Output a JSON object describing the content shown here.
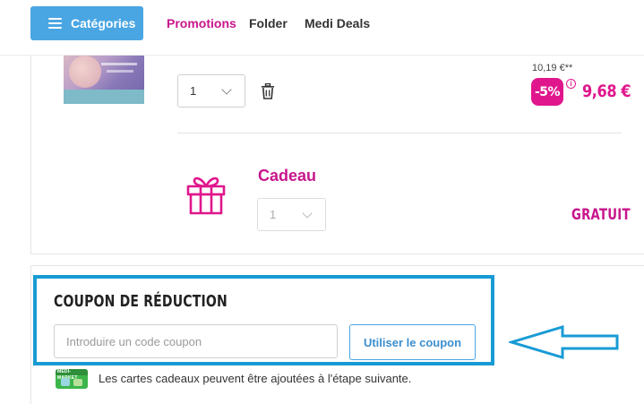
{
  "header": {
    "categories_label": "Catégories",
    "nav": [
      {
        "label": "Promotions",
        "color": "#c8158c"
      },
      {
        "label": "Folder"
      },
      {
        "label": "Medi Deals"
      }
    ]
  },
  "cart": {
    "product": {
      "quantity": "1",
      "old_price": "10,19 €**",
      "discount": "-5%",
      "info_symbol": "i",
      "new_price": "9,68 €"
    },
    "gift": {
      "title": "Cadeau",
      "quantity": "1",
      "price_label": "GRATUIT"
    }
  },
  "coupon": {
    "title": "COUPON DE RÉDUCTION",
    "input_placeholder": "Introduire un code coupon",
    "button_label": "Utiliser le coupon"
  },
  "gift_cards": {
    "icon_label": "MEDI-MARKET",
    "note": "Les cartes cadeaux peuvent être ajoutées à l'étape suivante."
  },
  "colors": {
    "brand_blue": "#4aa6e3",
    "brand_pink": "#e0168c",
    "highlight_blue": "#189bd5"
  }
}
